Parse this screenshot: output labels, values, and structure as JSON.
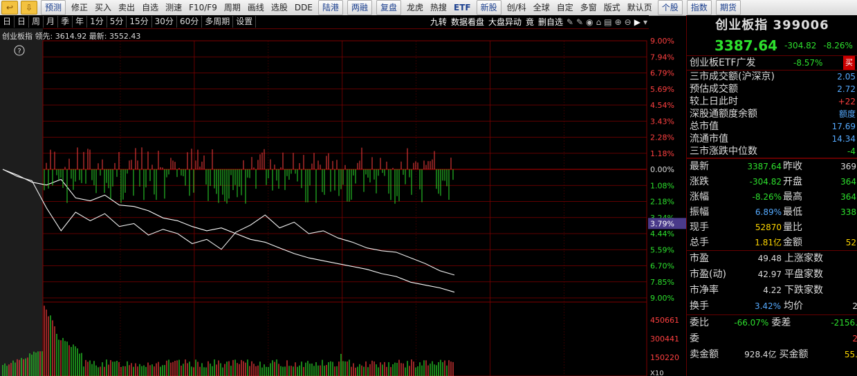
{
  "toolbar": {
    "items": [
      "预测",
      "修正",
      "买入",
      "卖出",
      "自选",
      "测速",
      "F10/F9",
      "周期",
      "画线",
      "选股",
      "DDE",
      "陆港",
      "两融",
      "复盘",
      "龙虎",
      "热搜",
      "ETF",
      "新股",
      "创/科",
      "全球",
      "自定",
      "多窗",
      "版式",
      "默认页",
      "个股",
      "指数",
      "期货"
    ],
    "button_items": [
      "预测",
      "陆港",
      "两融",
      "复盘",
      "新股",
      "个股",
      "指数",
      "期货"
    ]
  },
  "periods": [
    "日",
    "日",
    "周",
    "月",
    "季",
    "年",
    "1分",
    "5分",
    "15分",
    "30分",
    "60分",
    "多周期",
    "设置"
  ],
  "right_tools": [
    "九转",
    "数据看盘",
    "大盘异动",
    "竟",
    "删自选"
  ],
  "info_line": {
    "name": "创业板指",
    "leader_label": "领先:",
    "leader_value": "3614.92",
    "latest_label": "最新:",
    "latest_value": "3552.43"
  },
  "help_icon": "?",
  "axis": {
    "pct_labels": [
      "9.00%",
      "7.94%",
      "6.79%",
      "5.69%",
      "4.54%",
      "3.43%",
      "2.28%",
      "1.18%",
      "0.00%",
      "1.08%",
      "2.18%",
      "3.24%",
      "4.44%",
      "5.59%",
      "6.70%",
      "7.85%",
      "9.00%"
    ],
    "highlight_label": "3.79%",
    "vol_labels": [
      "450661",
      "300441",
      "150220"
    ],
    "vol_unit": "X10"
  },
  "chart_data": {
    "type": "line",
    "series": [
      {
        "values": [
          0,
          -0.4,
          -0.9,
          -1.1,
          -0.7,
          -2.0,
          -2.2,
          -1.8,
          -2.5,
          -2.6,
          -2.9,
          -3.4,
          -3.6,
          -4.0,
          -4.3,
          -4.1,
          -4.5,
          -4.9,
          -5.1,
          -5.5,
          -5.9,
          -6.2,
          -6.4,
          -6.6,
          -6.8,
          -7.0,
          -7.3,
          -7.5,
          -7.9,
          -8.1,
          -8.3,
          -8.6
        ]
      },
      {
        "values": [
          0,
          -0.5,
          -0.8,
          -2.7,
          -4.3,
          -3.0,
          -3.6,
          -3.1,
          -4.0,
          -3.8,
          -4.6,
          -4.2,
          -4.5,
          -5.2,
          -4.9,
          -5.6,
          -4.4,
          -3.9,
          -3.2,
          -4.1,
          -3.7,
          -4.5,
          -4.3,
          -4.8,
          -5.1,
          -5.5,
          -5.7,
          -5.8,
          -6.2,
          -6.6,
          -7.1,
          -7.4
        ]
      }
    ],
    "ylim": [
      -9.0,
      9.0
    ],
    "grid": true
  },
  "panel": {
    "title": "创业板指 399006",
    "price": "3387.64",
    "change": "-304.82",
    "change_pct": "-8.26%",
    "etf_name": "创业板ETF广发",
    "etf_pct": "-8.57%",
    "etf_buy": "买",
    "market": [
      {
        "k": "三市成交额(沪深京)",
        "v": "2.05"
      },
      {
        "k": "预估成交额",
        "v": "2.72"
      },
      {
        "k": "较上日此时",
        "v": "+22",
        "c": "red"
      },
      {
        "k": "深股通额度余额",
        "v": "额度"
      },
      {
        "k": "总市值",
        "v": "17.69"
      },
      {
        "k": "流通市值",
        "v": "14.34"
      },
      {
        "k": "三市涨跌中位数",
        "v": "-4",
        "c": "green"
      }
    ],
    "quote": [
      {
        "k1": "最新",
        "v1": "3387.64",
        "c1": "green",
        "k2": "昨收",
        "v2": "369",
        "c2": "white"
      },
      {
        "k1": "涨跌",
        "v1": "-304.82",
        "c1": "green",
        "k2": "开盘",
        "v2": "364",
        "c2": "green"
      },
      {
        "k1": "涨幅",
        "v1": "-8.26%",
        "c1": "green",
        "k2": "最高",
        "v2": "364",
        "c2": "green"
      },
      {
        "k1": "振幅",
        "v1": "6.89%",
        "c1": "blue",
        "k2": "最低",
        "v2": "338",
        "c2": "green"
      },
      {
        "k1": "现手",
        "v1": "52870",
        "c1": "yellow",
        "k2": "量比",
        "v2": "",
        "c2": "white"
      },
      {
        "k1": "总手",
        "v1": "1.81亿",
        "c1": "yellow",
        "k2": "金额",
        "v2": "52",
        "c2": "yellow"
      }
    ],
    "stats": [
      {
        "k1": "市盈",
        "v1": "49.48",
        "k2": "上涨家数",
        "v2": ""
      },
      {
        "k1": "市盈(动)",
        "v1": "42.97",
        "k2": "平盘家数",
        "v2": ""
      },
      {
        "k1": "市净率",
        "v1": "4.22",
        "k2": "下跌家数",
        "v2": ""
      },
      {
        "k1": "换手",
        "v1": "3.42%",
        "c1": "blue",
        "k2": "均价",
        "v2": "2"
      }
    ],
    "order": [
      {
        "k1": "委比",
        "v1": "-66.07%",
        "c1": "green",
        "k2": "委差",
        "v2": "-2156.",
        "c2": "green"
      },
      {
        "k1": "委",
        "v1": "",
        "k2": "",
        "v2": "2",
        "c2": "red"
      },
      {
        "k1": "卖金额",
        "v1": "928.4亿",
        "k2": "买金额",
        "v2": "55.",
        "c2": "yellow"
      }
    ]
  }
}
